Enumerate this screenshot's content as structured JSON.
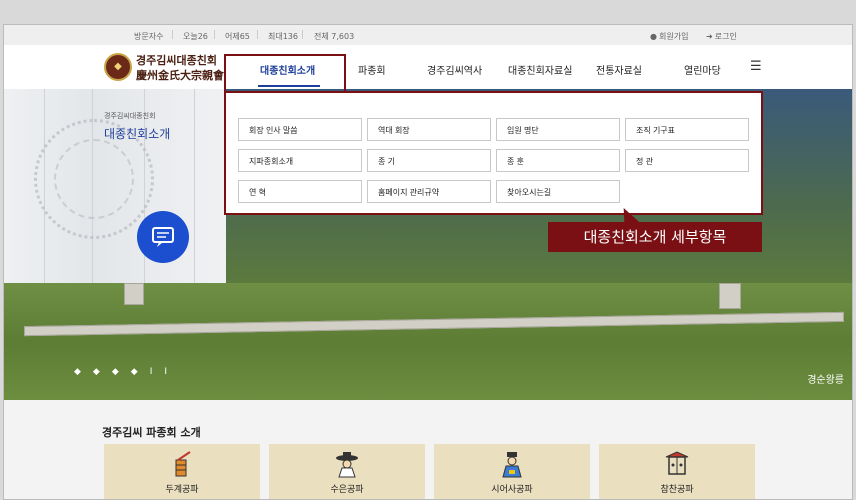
{
  "topbar": {
    "visitor_label": "방문자수",
    "today": "오늘26",
    "yesterday": "어제65",
    "max": "최대136",
    "total": "전체 7,603",
    "join": "회원가입",
    "login": "로그인"
  },
  "logo": {
    "title_ko": "경주김씨대종친회",
    "title_hanja": "慶州金氏大宗親會"
  },
  "nav": {
    "items": [
      "대종친회소개",
      "파종회",
      "경주김씨역사",
      "대종친회자료실",
      "전통자료실",
      "열린마당"
    ],
    "active": "대종친회소개"
  },
  "side": {
    "subtitle": "경주김씨대종친회",
    "title": "대종친회소개"
  },
  "dropdown": {
    "items": [
      "회장 인사 말씀",
      "역대 회장",
      "임원 명단",
      "조직 기구표",
      "지파종회소개",
      "종 기",
      "종 훈",
      "정 관",
      "연 혁",
      "홈페이지 관리규약",
      "찾아오시는길"
    ]
  },
  "callout": "대종친회소개 세부항목",
  "hero": {
    "caption": "경순왕릉",
    "pause": "II"
  },
  "section": {
    "title": "경주김씨 파종회 소개",
    "cards": [
      {
        "label": "두계공파",
        "icon": "book-pen-icon"
      },
      {
        "label": "수은공파",
        "icon": "scholar-hat-icon"
      },
      {
        "label": "시어사공파",
        "icon": "official-robe-icon"
      },
      {
        "label": "참찬공파",
        "icon": "shrine-icon"
      }
    ]
  },
  "colors": {
    "accent_blue": "#1f3f9c",
    "highlight_red": "#7a1014",
    "card_bg": "#eadfbf"
  }
}
